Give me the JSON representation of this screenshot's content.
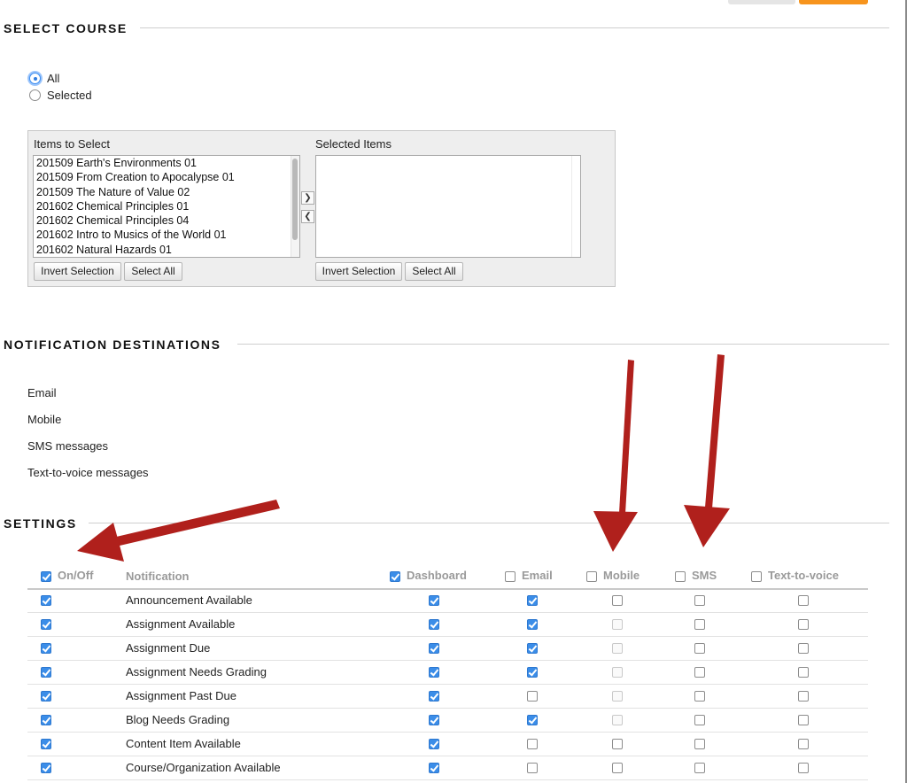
{
  "sections": {
    "select_course": "SELECT COURSE",
    "notification_destinations": "NOTIFICATION DESTINATIONS",
    "settings": "SETTINGS"
  },
  "course_scope": {
    "options": [
      {
        "label": "All",
        "checked": true
      },
      {
        "label": "Selected",
        "checked": false
      }
    ]
  },
  "picker": {
    "items_label": "Items to Select",
    "selected_label": "Selected Items",
    "items": [
      "201509 Earth's Environments 01",
      "201509 From Creation to Apocalypse 01",
      "201509 The Nature of Value 02",
      "201602 Chemical Principles 01",
      "201602 Chemical Principles 04",
      "201602 Intro to Musics of the World 01",
      "201602 Natural Hazards 01"
    ],
    "selected_items": [],
    "move_right_icon": "chevron-right-icon",
    "move_left_icon": "chevron-left-icon",
    "invert_label": "Invert Selection",
    "select_all_label": "Select All"
  },
  "destinations": [
    "Email",
    "Mobile",
    "SMS messages",
    "Text-to-voice messages"
  ],
  "settings": {
    "headers": {
      "onoff": "On/Off",
      "notification": "Notification",
      "dashboard": "Dashboard",
      "email": "Email",
      "mobile": "Mobile",
      "sms": "SMS",
      "tts": "Text-to-voice"
    },
    "header_checked": {
      "onoff": true,
      "dashboard": true,
      "email": false,
      "mobile": false,
      "sms": false,
      "tts": false
    },
    "rows": [
      {
        "name": "Announcement Available",
        "on": true,
        "dashboard": true,
        "email": true,
        "mobile": "off",
        "sms": false,
        "tts": false
      },
      {
        "name": "Assignment Available",
        "on": true,
        "dashboard": true,
        "email": true,
        "mobile": "disabled",
        "sms": false,
        "tts": false
      },
      {
        "name": "Assignment Due",
        "on": true,
        "dashboard": true,
        "email": true,
        "mobile": "disabled",
        "sms": false,
        "tts": false
      },
      {
        "name": "Assignment Needs Grading",
        "on": true,
        "dashboard": true,
        "email": true,
        "mobile": "disabled",
        "sms": false,
        "tts": false
      },
      {
        "name": "Assignment Past Due",
        "on": true,
        "dashboard": true,
        "email": false,
        "mobile": "disabled",
        "sms": false,
        "tts": false
      },
      {
        "name": "Blog Needs Grading",
        "on": true,
        "dashboard": true,
        "email": true,
        "mobile": "disabled",
        "sms": false,
        "tts": false
      },
      {
        "name": "Content Item Available",
        "on": true,
        "dashboard": true,
        "email": false,
        "mobile": "off",
        "sms": false,
        "tts": false
      },
      {
        "name": "Course/Organization Available",
        "on": true,
        "dashboard": true,
        "email": false,
        "mobile": "off",
        "sms": false,
        "tts": false
      }
    ]
  },
  "colors": {
    "accent_orange": "#f7941d",
    "checkbox_blue": "#3b8de8",
    "annotation_arrow": "#b0201c"
  }
}
